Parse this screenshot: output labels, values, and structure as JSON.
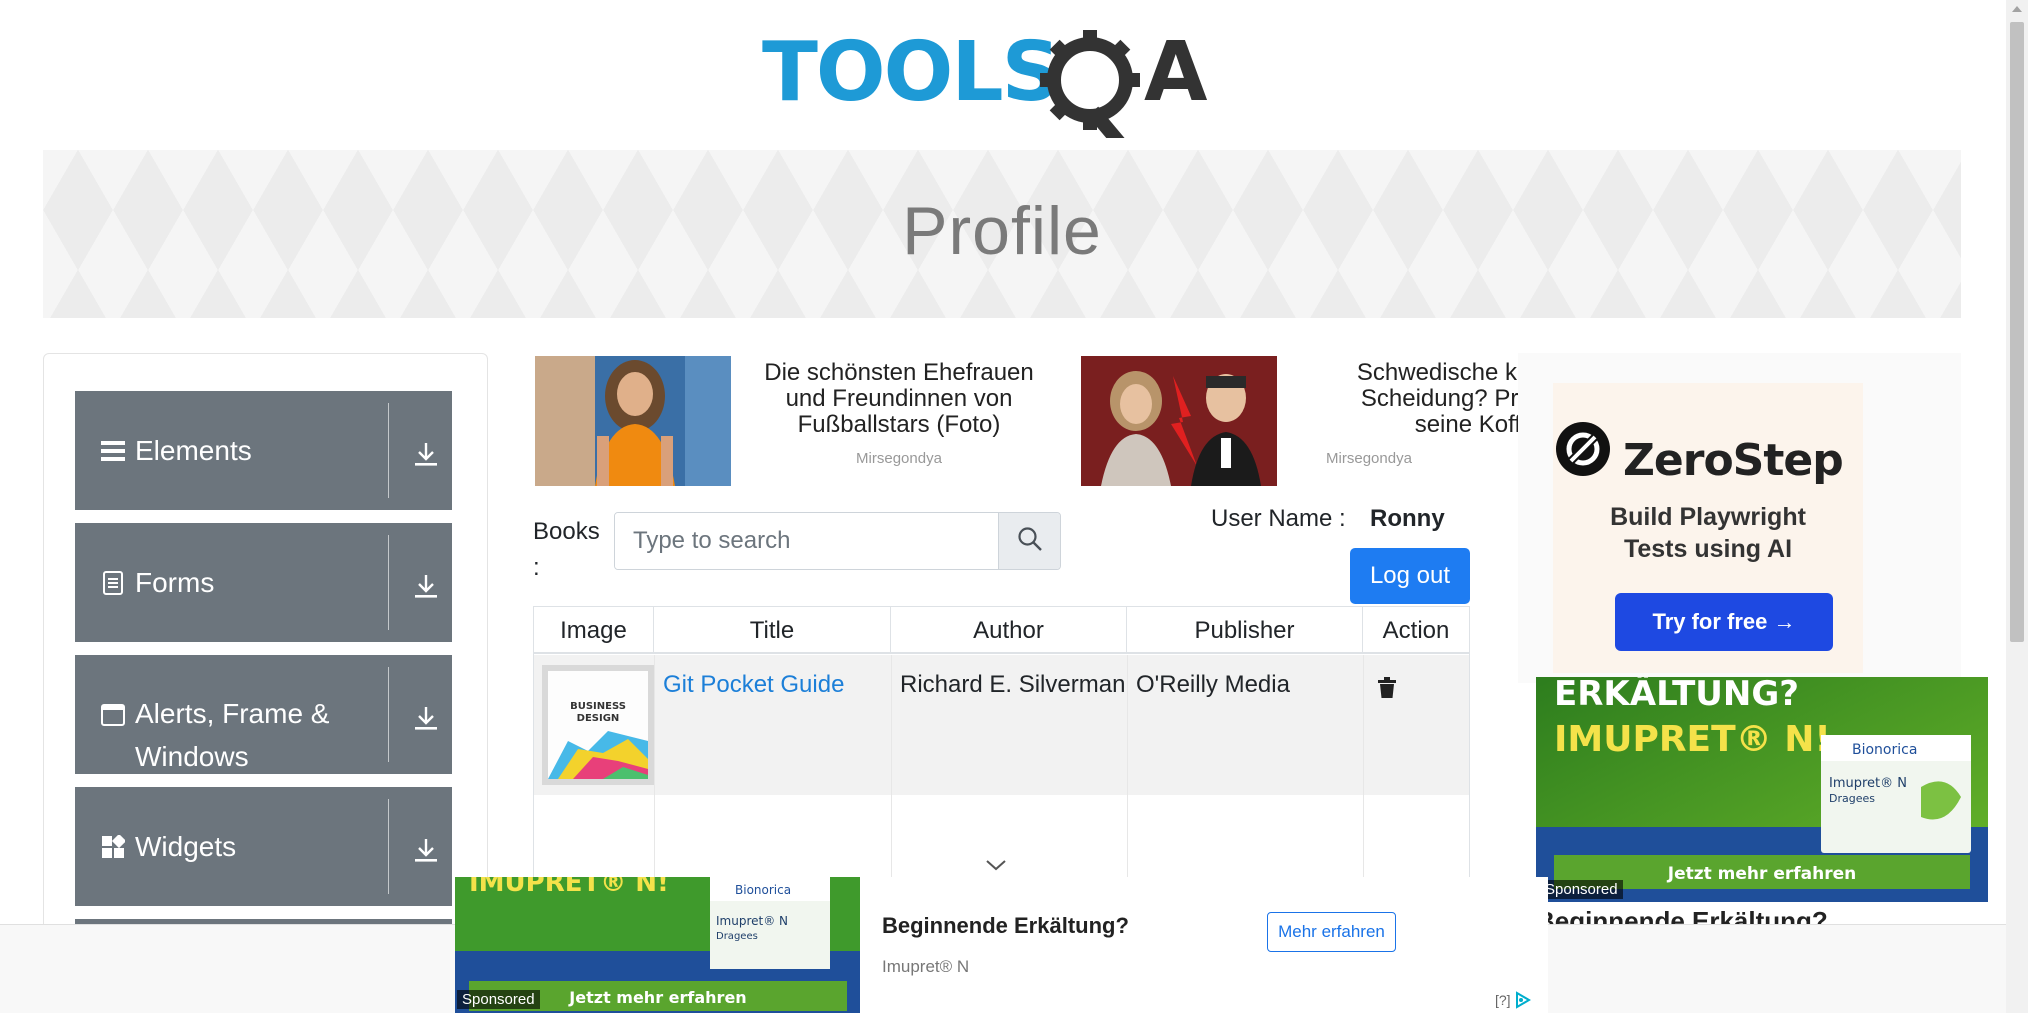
{
  "header": {
    "logo_text": "TOOLSQA",
    "page_title": "Profile"
  },
  "sidebar": {
    "groups": [
      {
        "label": "Elements",
        "icon": "hamburger-icon"
      },
      {
        "label": "Forms",
        "icon": "document-icon"
      },
      {
        "label": "Alerts, Frame & Windows",
        "label_line1": "Alerts, Frame &",
        "label_line2": "Windows",
        "icon": "window-icon"
      },
      {
        "label": "Widgets",
        "icon": "widgets-icon"
      }
    ]
  },
  "ads": {
    "top": [
      {
        "title_line1": "Die schönsten Ehefrauen",
        "title_line2": "und Freundinnen von",
        "title_line3": "Fußballstars (Foto)",
        "source": "Mirsegondya"
      },
      {
        "title_line1": "Schwedische köni",
        "title_line2": "Scheidung? Prinz",
        "title_line3": "seine Koffer!",
        "source": "Mirsegondya"
      }
    ],
    "zerostep": {
      "name": "ZeroStep",
      "tag_line1": "Build Playwright",
      "tag_line2": "Tests using AI",
      "button": "Try for free →"
    },
    "imupret": {
      "headline1": "ERKÄLTUNG?",
      "headline2": "IMUPRET® N!",
      "brand": "Bionorica",
      "product": "Imupret® N",
      "product_sub": "Dragees",
      "cta": "Jetzt mehr erfahren",
      "sponsored": "Sponsored",
      "below_title": "Beginnende Erkältung?"
    },
    "bottom": {
      "title": "Beginnende Erkältung?",
      "subtitle": "Imupret® N",
      "button": "Mehr erfahren",
      "qm": "[?]",
      "sponsored": "Sponsored",
      "cta": "Jetzt mehr erfahren",
      "headline": "IMUPRET® N!",
      "brand": "Bionorica",
      "product": "Imupret® N",
      "product_sub": "Dragees"
    }
  },
  "books": {
    "label": "Books :",
    "label_line1": "Books",
    "label_line2": ":",
    "search_placeholder": "Type to search"
  },
  "user": {
    "label": "User Name :",
    "value": "Ronny",
    "logout": "Log out"
  },
  "table": {
    "columns": [
      "Image",
      "Title",
      "Author",
      "Publisher",
      "Action"
    ],
    "rows": [
      {
        "image_text_1": "BUSINESS",
        "image_text_2": "DESIGN",
        "title": "Git Pocket Guide",
        "author": "Richard E. Silverman",
        "publisher": "O'Reilly Media",
        "action": "trash-icon"
      }
    ]
  },
  "colors": {
    "sidebar_group": "#6c757d",
    "primary_button": "#1e7cf2",
    "link": "#1c7fd8",
    "logo_blue": "#1e9ad6",
    "logo_dark": "#333333",
    "zerostep_button": "#1e49e2",
    "imupret_green": "#3f9a2c"
  }
}
